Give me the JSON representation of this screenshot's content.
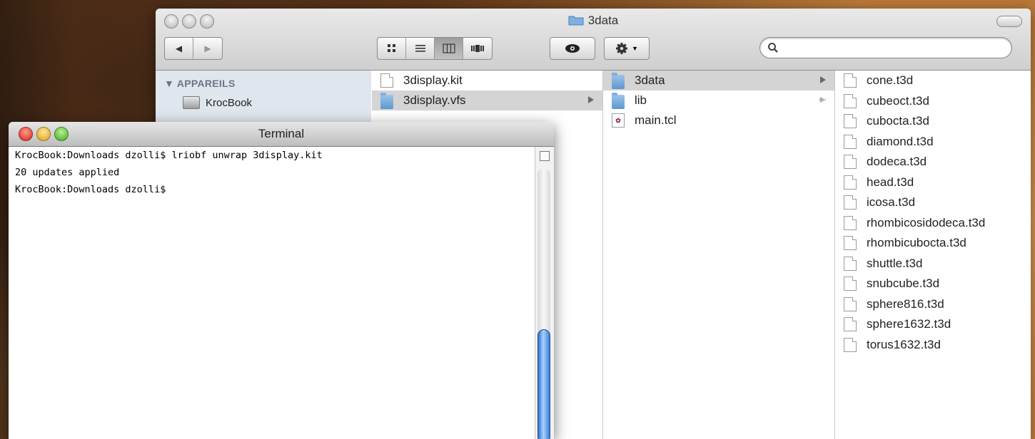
{
  "finder": {
    "title": "3data",
    "nav": {
      "back": "◀",
      "forward": "▶"
    },
    "view_buttons": [
      "icon-view",
      "list-view",
      "column-view",
      "coverflow-view"
    ],
    "search": {
      "value": "",
      "placeholder": ""
    },
    "sidebar": {
      "section": "▼ APPAREILS",
      "items": [
        {
          "label": "KrocBook",
          "icon": "hard-drive-icon"
        }
      ]
    },
    "column1": [
      {
        "label": "3display.kit",
        "type": "file"
      },
      {
        "label": "3display.vfs",
        "type": "folder",
        "selected": true
      }
    ],
    "column2": [
      {
        "label": "3data",
        "type": "folder",
        "selected": true
      },
      {
        "label": "lib",
        "type": "folder"
      },
      {
        "label": "main.tcl",
        "type": "tcl-file"
      }
    ],
    "column3": [
      "cone.t3d",
      "cubeoct.t3d",
      "cubocta.t3d",
      "diamond.t3d",
      "dodeca.t3d",
      "head.t3d",
      "icosa.t3d",
      "rhombicosidodeca.t3d",
      "rhombicubocta.t3d",
      "shuttle.t3d",
      "snubcube.t3d",
      "sphere816.t3d",
      "sphere1632.t3d",
      "torus1632.t3d"
    ]
  },
  "terminal": {
    "title": "Terminal",
    "lines": [
      "KrocBook:Downloads dzolli$ lriobf unwrap 3display.kit",
      "20 updates applied",
      "KrocBook:Downloads dzolli$"
    ]
  },
  "colors": {
    "selection": "#d4d4d4",
    "sidebar": "#e0e6ee",
    "scroll_thumb": "#3b7fd8"
  }
}
